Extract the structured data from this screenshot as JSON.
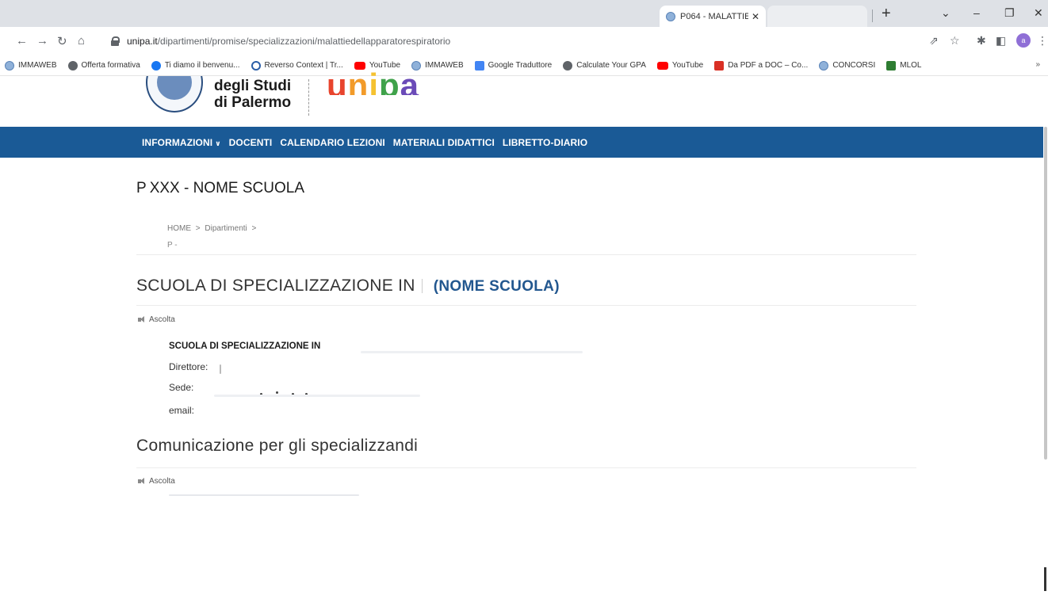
{
  "browser": {
    "tab_title": "P064 - MALATTIE",
    "new_tab": "+",
    "url_host": "unipa.it",
    "url_path": "/dipartimenti/promise/specializzazioni/malattiedellapparatorespiratorio",
    "profile_initial": "a",
    "bookmarks": [
      {
        "label": "IMMAWEB",
        "icon": "web-icon"
      },
      {
        "label": "Offerta formativa",
        "icon": "globe-icon"
      },
      {
        "label": "Ti diamo il benvenu...",
        "icon": "facebook-icon"
      },
      {
        "label": "Reverso Context | Tr...",
        "icon": "reverso-icon"
      },
      {
        "label": "YouTube",
        "icon": "youtube-icon"
      },
      {
        "label": "IMMAWEB",
        "icon": "web-icon"
      },
      {
        "label": "Google Traduttore",
        "icon": "translate-icon"
      },
      {
        "label": "Calculate Your GPA",
        "icon": "globe-icon"
      },
      {
        "label": "YouTube",
        "icon": "youtube-icon"
      },
      {
        "label": "Da PDF a DOC – Co...",
        "icon": "pdf-icon"
      },
      {
        "label": "CONCORSI",
        "icon": "web-icon"
      },
      {
        "label": "MLOL",
        "icon": "mlol-icon"
      }
    ],
    "bookmarks_more": "»"
  },
  "header": {
    "logo_line1": "degli Studi",
    "logo_line2": "di Palermo",
    "brand": [
      "u",
      "n",
      "i",
      "p",
      "a"
    ]
  },
  "nav": {
    "items": [
      "INFORMAZIONI",
      "DOCENTI",
      "CALENDARIO LEZIONI",
      "MATERIALI DIDATTICI",
      "LIBRETTO-DIARIO"
    ]
  },
  "main": {
    "title_prefix": "P",
    "title": "XXX -  NOME SCUOLA",
    "breadcrumb": [
      "HOME",
      ">",
      "Dipartimenti",
      ">"
    ],
    "breadcrumb_sub": "P  -",
    "section1_title": "SCUOLA DI SPECIALIZZAZIONE IN",
    "section1_accent": "(NOME SCUOLA)",
    "listen_label": "Ascolta",
    "school_heading": "SCUOLA DI SPECIALIZZAZIONE IN",
    "director_label": "Direttore:",
    "seat_label": "Sede:",
    "email_label": "email:",
    "section2_title": "Comunicazione per gli specializzandi",
    "listen_label2": "Ascolta"
  },
  "colors": {
    "nav_bg": "#1a5a96",
    "accent": "#22578f"
  }
}
